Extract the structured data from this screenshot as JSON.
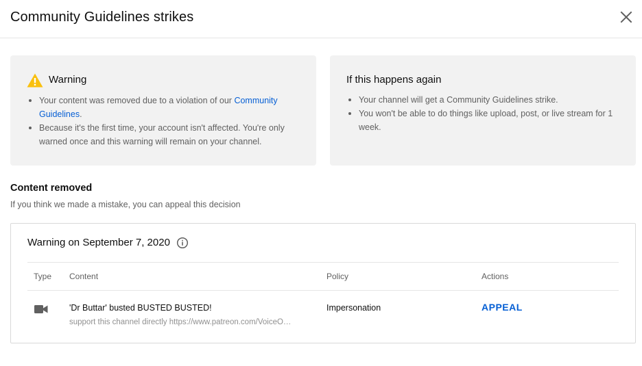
{
  "dialog": {
    "title": "Community Guidelines strikes",
    "close_icon": "close-icon"
  },
  "warning_panel": {
    "icon": "warning-triangle-icon",
    "heading": "Warning",
    "bullet1_prefix": "Your content was removed due to a violation of our ",
    "bullet1_link": "Community Guidelines",
    "bullet1_suffix": ".",
    "bullet2": "Because it's the first time, your account isn't affected. You're only warned once and this warning will remain on your channel."
  },
  "again_panel": {
    "heading": "If this happens again",
    "bullets": [
      "Your channel will get a Community Guidelines strike.",
      "You won't be able to do things like upload, post, or live stream for 1 week."
    ]
  },
  "content_removed": {
    "title": "Content removed",
    "subtitle": "If you think we made a mistake, you can appeal this decision"
  },
  "card": {
    "title": "Warning on September 7, 2020",
    "info_icon": "info-icon",
    "columns": {
      "type": "Type",
      "content": "Content",
      "policy": "Policy",
      "actions": "Actions"
    },
    "row": {
      "type_icon": "video-camera-icon",
      "title": "'Dr Buttar' busted BUSTED BUSTED!",
      "description": "support this channel directly https://www.patreon.com/VoiceO…",
      "policy": "Impersonation",
      "action": "APPEAL"
    }
  },
  "colors": {
    "link": "#065fd4",
    "panel_bg": "#f2f2f2",
    "warning_icon": "#f9c00f",
    "secondary_text": "#606060"
  }
}
